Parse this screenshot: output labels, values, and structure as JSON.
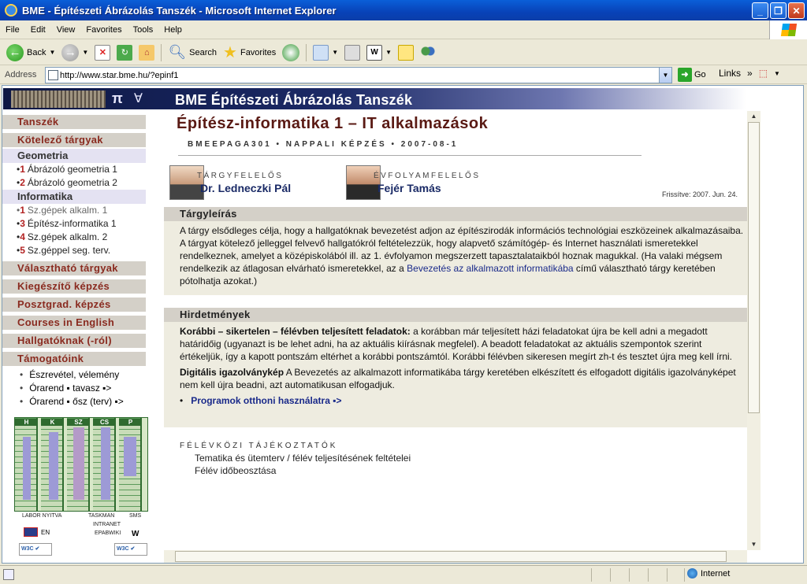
{
  "window": {
    "title": "BME - Építészeti Ábrázolás Tanszék - Microsoft Internet Explorer"
  },
  "menu": [
    "File",
    "Edit",
    "View",
    "Favorites",
    "Tools",
    "Help"
  ],
  "toolbar": {
    "back": "Back",
    "search": "Search",
    "favorites": "Favorites"
  },
  "address": {
    "label": "Address",
    "url": "http://www.star.bme.hu/?epinf1",
    "go": "Go",
    "links": "Links"
  },
  "banner": {
    "title": "BME Építészeti Ábrázolás Tanszék"
  },
  "sidebar": {
    "tanszek": "Tanszék",
    "kotelezo": "Kötelező tárgyak",
    "geometria": "Geometria",
    "geo_items": [
      {
        "num": "1",
        "label": "Ábrázoló geometria 1"
      },
      {
        "num": "2",
        "label": "Ábrázoló geometria 2"
      }
    ],
    "informatika": "Informatika",
    "inf_items": [
      {
        "num": "1",
        "label": "Sz.gépek alkalm. 1"
      },
      {
        "num": "3",
        "label": "Építész-informatika 1"
      },
      {
        "num": "4",
        "label": "Sz.gépek alkalm. 2"
      },
      {
        "num": "5",
        "label": "Sz.géppel seg. terv."
      }
    ],
    "valaszthato": "Választható tárgyak",
    "kiegeszito": "Kiegészítő képzés",
    "posztgrad": "Posztgrad. képzés",
    "courses": "Courses in English",
    "hallgatok": "Hallgatóknak (-ról)",
    "tamogatoink": "Támogatóink",
    "links": [
      "Észrevétel, vélemény",
      "Órarend ▪ tavasz ▪>",
      "Órarend ▪ ősz (terv) ▪>"
    ],
    "sched_days": [
      "H",
      "K",
      "SZ",
      "CS",
      "P"
    ],
    "sched_labels": [
      "LABOR NYITVA",
      "TASKMAN",
      "SMS",
      "INTRANET",
      "EPABWIKI",
      "EN",
      "W"
    ]
  },
  "page": {
    "title": "Építész-informatika 1 – IT alkalmazások",
    "code": "BMEEPAGA301 • NAPPALI KÉPZÉS • 2007-08-1",
    "role1": "TÁRGYFELELŐS",
    "name1": "Dr. Ledneczki Pál",
    "role2": "ÉVFOLYAMFELELŐS",
    "name2": "Fejér Tamás",
    "updated": "Frissítve: 2007. Jun. 24."
  },
  "leiras": {
    "heading": "Tárgyleírás",
    "text1": "A tárgy elsődleges célja, hogy a hallgatóknak bevezetést adjon az építészirodák információs technológiai eszközeinek alkalmazásaiba. A tárgyat kötelező jelleggel felvevő hallgatókról feltételezzük, hogy alapvető számítógép- és Internet használati ismeretekkel rendelkeznek, amelyet a középiskolából ill. az 1. évfolyamon megszerzett tapasztalataikból hoznak magukkal. (Ha valaki mégsem rendelkezik az átlagosan elvárható ismeretekkel, az a ",
    "link": "Bevezetés az alkalmazott informatikába",
    "text2": " című választható tárgy keretében pótolhatja azokat.)"
  },
  "hirdetmenyek": {
    "heading": "Hirdetmények",
    "b1": "Korábbi – sikertelen – félévben teljesített feladatok:",
    "t1": " a korábban már teljesített házi feladatokat újra be kell adni a megadott határidőig (ugyanazt is be lehet adni, ha az aktuális kiírásnak megfelel). A beadott feladatokat az aktuális szempontok szerint értékeljük, így a kapott pontszám eltérhet a korábbi pontszámtól. Korábbi félévben sikeresen megírt zh-t és tesztet újra meg kell írni.",
    "b2": "Digitális igazolványkép",
    "t2": " A Bevezetés az alkalmazott informatikába tárgy keretében elkészített és elfogadott digitális igazolványképet nem kell újra beadni, azt automatikusan elfogadjuk.",
    "link": "Programok otthoni használatra ▪>"
  },
  "felevkozi": {
    "heading": "FÉLÉVKÖZI TÁJÉKOZTATÓK",
    "l1": "Tematika és ütemterv",
    "sep": " / ",
    "l2": "félév teljesítésének feltételei",
    "l3": "Félév időbeosztása"
  },
  "status": {
    "zone": "Internet"
  }
}
